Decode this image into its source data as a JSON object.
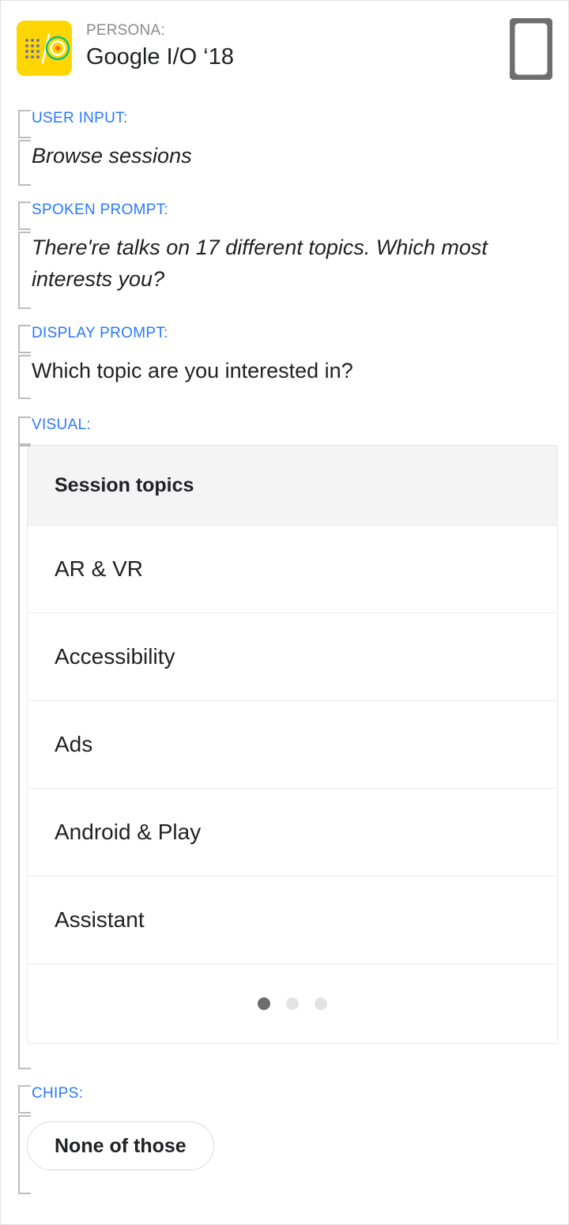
{
  "persona": {
    "label": "PERSONA:",
    "name": "Google I/O ‘18",
    "logo_icon": "google-io-logo",
    "logo_colors": {
      "background": "#ffd600",
      "dots": "#5c6bc0",
      "slash": "#ffffff",
      "ring_outer": "#00c389",
      "ring_inner": "#ffffff",
      "center": "#ff6d00"
    }
  },
  "device": {
    "icon": "mobile-device-icon",
    "color": "#6e6e6e"
  },
  "sections": {
    "user_input": {
      "label": "USER INPUT:",
      "value": "Browse sessions"
    },
    "spoken_prompt": {
      "label": "SPOKEN PROMPT:",
      "value": "There're talks on 17 different topics. Which most interests you?"
    },
    "display_prompt": {
      "label": "DISPLAY PROMPT:",
      "value": "Which topic are you interested in?"
    },
    "visual": {
      "label": "VISUAL:"
    },
    "chips": {
      "label": "CHIPS:"
    }
  },
  "visual_card": {
    "header_title": "Session topics",
    "items": [
      {
        "label": "AR & VR"
      },
      {
        "label": "Accessibility"
      },
      {
        "label": "Ads"
      },
      {
        "label": "Android & Play"
      },
      {
        "label": "Assistant"
      }
    ],
    "pager": {
      "total": 3,
      "active_index": 0
    }
  },
  "chips": [
    {
      "label": "None of those"
    }
  ],
  "colors": {
    "accent_blue": "#2979ff",
    "bracket_gray": "#bdbdbd",
    "text_primary": "#202124",
    "muted_gray": "#8a8a8a",
    "card_header_bg": "#f4f4f4",
    "dot_active": "#6e6e6e",
    "dot_inactive": "#e3e3e3"
  }
}
